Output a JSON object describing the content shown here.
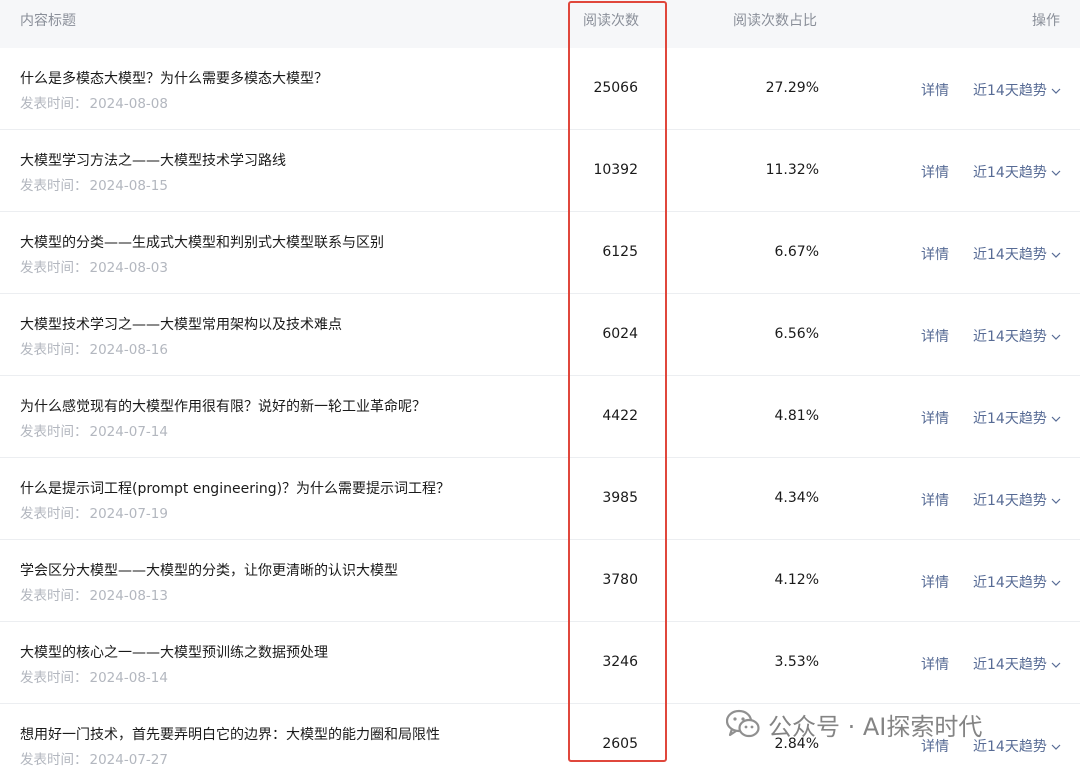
{
  "table": {
    "headers": {
      "title": "内容标题",
      "reads": "阅读次数",
      "ratio": "阅读次数占比",
      "action": "操作"
    },
    "date_label": "发表时间：",
    "detail_label": "详情",
    "trend_label": "近14天趋势",
    "rows": [
      {
        "title": "什么是多模态大模型？为什么需要多模态大模型？",
        "date": "2024-08-08",
        "reads": "25066",
        "ratio": "27.29%"
      },
      {
        "title": "大模型学习方法之——大模型技术学习路线",
        "date": "2024-08-15",
        "reads": "10392",
        "ratio": "11.32%"
      },
      {
        "title": "大模型的分类——生成式大模型和判别式大模型联系与区别",
        "date": "2024-08-03",
        "reads": "6125",
        "ratio": "6.67%"
      },
      {
        "title": "大模型技术学习之——大模型常用架构以及技术难点",
        "date": "2024-08-16",
        "reads": "6024",
        "ratio": "6.56%"
      },
      {
        "title": "为什么感觉现有的大模型作用很有限？说好的新一轮工业革命呢？",
        "date": "2024-07-14",
        "reads": "4422",
        "ratio": "4.81%"
      },
      {
        "title": "什么是提示词工程(prompt engineering)？为什么需要提示词工程？",
        "date": "2024-07-19",
        "reads": "3985",
        "ratio": "4.34%"
      },
      {
        "title": "学会区分大模型——大模型的分类，让你更清晰的认识大模型",
        "date": "2024-08-13",
        "reads": "3780",
        "ratio": "4.12%"
      },
      {
        "title": "大模型的核心之一——大模型预训练之数据预处理",
        "date": "2024-08-14",
        "reads": "3246",
        "ratio": "3.53%"
      },
      {
        "title": "想用好一门技术，首先要弄明白它的边界：大模型的能力圈和局限性",
        "date": "2024-07-27",
        "reads": "2605",
        "ratio": "2.84%"
      }
    ]
  },
  "watermark": {
    "text": "公众号 · AI探索时代"
  },
  "colors": {
    "link": "#576b95",
    "highlight": "#e0473c",
    "header_bg": "#f6f7f9",
    "muted": "#b3b7bf"
  }
}
